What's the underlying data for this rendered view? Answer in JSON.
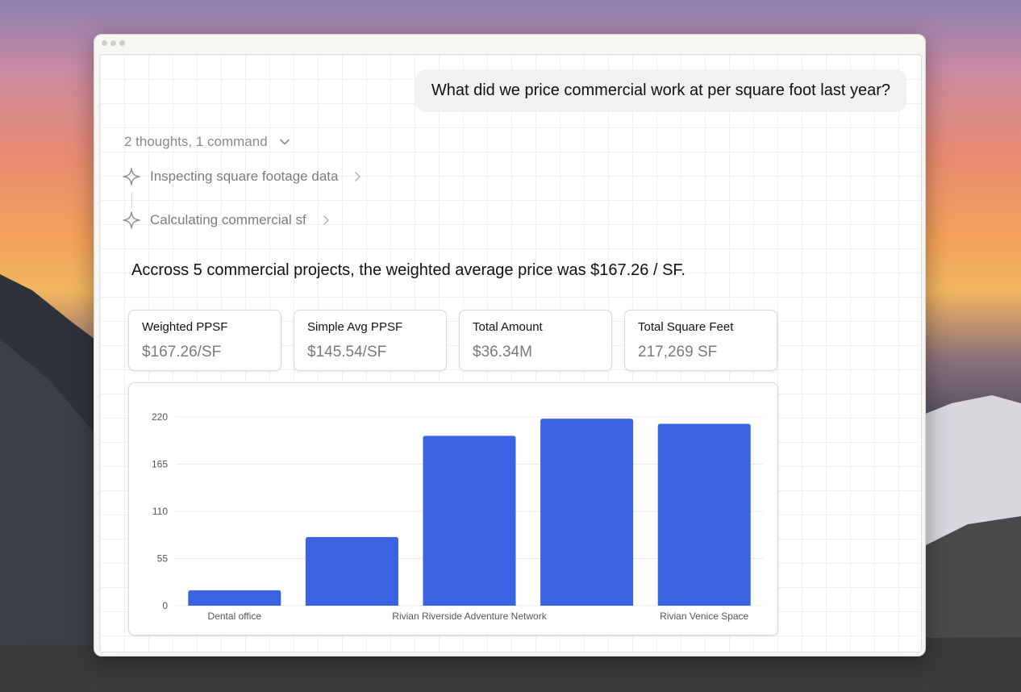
{
  "user_message": "What did we price commercial work at per square foot last year?",
  "thoughts": {
    "summary": "2 thoughts, 1 command",
    "steps": [
      {
        "label": "Inspecting square footage data",
        "icon": "sparkle-icon"
      },
      {
        "label": "Calculating commercial sf",
        "icon": "sparkle-icon"
      }
    ]
  },
  "answer": "Accross 5 commercial projects, the weighted average price was $167.26 / SF.",
  "metrics": [
    {
      "label": "Weighted PPSF",
      "value": "$167.26/SF"
    },
    {
      "label": "Simple Avg PPSF",
      "value": "$145.54/SF"
    },
    {
      "label": "Total Amount",
      "value": "$36.34M"
    },
    {
      "label": "Total Square Feet",
      "value": "217,269 SF"
    }
  ],
  "colors": {
    "bar": "#3a63e2",
    "window_bg": "#f7f6f3"
  },
  "chart_data": {
    "type": "bar",
    "categories": [
      "Dental office",
      "",
      "Rivian Riverside Adventure Network",
      "",
      "Rivian Venice Space"
    ],
    "values": [
      18,
      80,
      198,
      218,
      212
    ],
    "yticks": [
      0,
      55,
      110,
      165,
      220
    ],
    "ylim": [
      0,
      220
    ],
    "grid": true,
    "title": "",
    "xlabel": "",
    "ylabel": ""
  }
}
